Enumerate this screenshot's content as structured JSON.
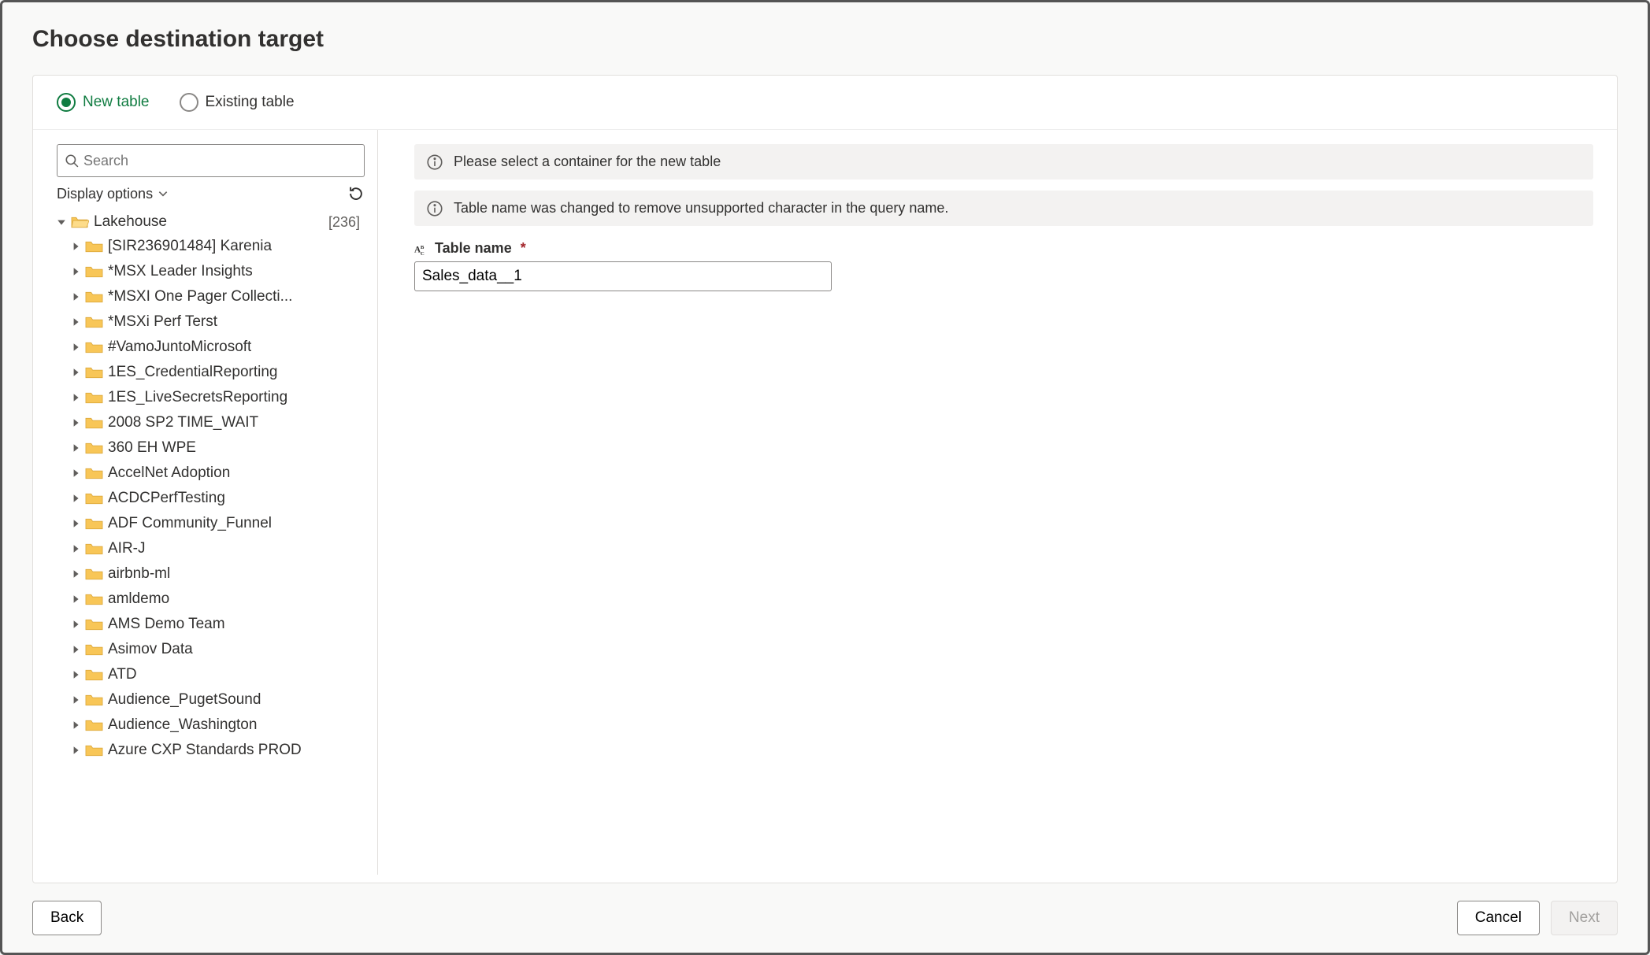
{
  "title": "Choose destination target",
  "radios": {
    "new_table": "New table",
    "existing_table": "Existing table"
  },
  "search": {
    "placeholder": "Search"
  },
  "display_options_label": "Display options",
  "tree": {
    "root_label": "Lakehouse",
    "root_count": "[236]",
    "items": [
      "[SIR236901484] Karenia",
      "*MSX Leader Insights",
      "*MSXI One Pager Collecti...",
      "*MSXi Perf Terst",
      "#VamoJuntoMicrosoft",
      "1ES_CredentialReporting",
      "1ES_LiveSecretsReporting",
      "2008 SP2 TIME_WAIT",
      "360 EH WPE",
      "AccelNet Adoption",
      "ACDCPerfTesting",
      "ADF Community_Funnel",
      "AIR-J",
      "airbnb-ml",
      "amldemo",
      "AMS Demo Team",
      "Asimov Data",
      "ATD",
      "Audience_PugetSound",
      "Audience_Washington",
      "Azure CXP Standards PROD"
    ]
  },
  "banners": {
    "select_container": "Please select a container for the new table",
    "name_changed": "Table name was changed to remove unsupported character in the query name."
  },
  "form": {
    "table_name_label": "Table name",
    "table_name_value": "Sales_data__1"
  },
  "buttons": {
    "back": "Back",
    "cancel": "Cancel",
    "next": "Next"
  }
}
